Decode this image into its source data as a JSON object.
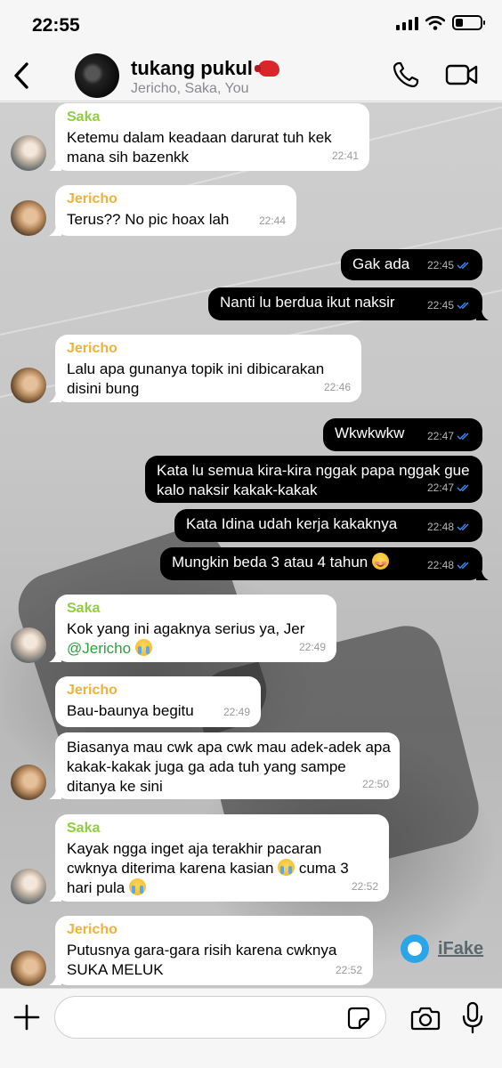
{
  "status_bar": {
    "time": "22:55"
  },
  "header": {
    "title": "tukang pukul",
    "members": "Jericho, Saka, You"
  },
  "colors": {
    "saka_name": "#8fce44",
    "jericho_name": "#f0b23a",
    "tick_blue": "#3a8df5",
    "outgoing_bubble": "#000000",
    "incoming_bubble": "#ffffff"
  },
  "messages": [
    {
      "sender": "Saka",
      "text": "Ketemu dalam keadaan darurat tuh kek mana sih bazenkk",
      "time": "22:41"
    },
    {
      "sender": "Jericho",
      "text": "Terus?? No pic hoax lah",
      "time": "22:44"
    },
    {
      "sender": "You",
      "text": "Gak ada",
      "time": "22:45"
    },
    {
      "sender": "You",
      "text": "Nanti lu berdua ikut naksir",
      "time": "22:45"
    },
    {
      "sender": "Jericho",
      "text": "Lalu apa gunanya topik ini dibicarakan disini bung",
      "time": "22:46"
    },
    {
      "sender": "You",
      "text": "Wkwkwkw",
      "time": "22:47"
    },
    {
      "sender": "You",
      "text": "Kata lu semua kira-kira nggak papa nggak gue kalo naksir kakak-kakak",
      "time": "22:47"
    },
    {
      "sender": "You",
      "text": "Kata Idina udah kerja kakaknya",
      "time": "22:48"
    },
    {
      "sender": "You",
      "text": "Mungkin beda 3 atau 4 tahun",
      "emoji": "smiling-face",
      "time": "22:48"
    },
    {
      "sender": "Saka",
      "text": "Kok yang ini agaknya serius ya, Jer",
      "mention": "@Jericho",
      "emoji": "crying-face",
      "time": "22:49"
    },
    {
      "sender": "Jericho",
      "text": "Bau-baunya begitu",
      "time": "22:49"
    },
    {
      "sender": "Jericho",
      "text": "Biasanya mau cwk apa cwk mau adek-adek apa kakak-kakak juga ga ada tuh yang sampe ditanya ke sini",
      "time": "22:50"
    },
    {
      "sender": "Saka",
      "text": "Kayak ngga inget aja terakhir pacaran cwknya diterima karena kasian",
      "text2": "cuma 3 hari pula",
      "emoji": "crying-face",
      "time": "22:52"
    },
    {
      "sender": "Jericho",
      "text": "Putusnya gara-gara risih karena cwknya SUKA MELUK",
      "time": "22:52"
    }
  ],
  "watermark": {
    "label": "iFake"
  },
  "input": {
    "placeholder": ""
  }
}
